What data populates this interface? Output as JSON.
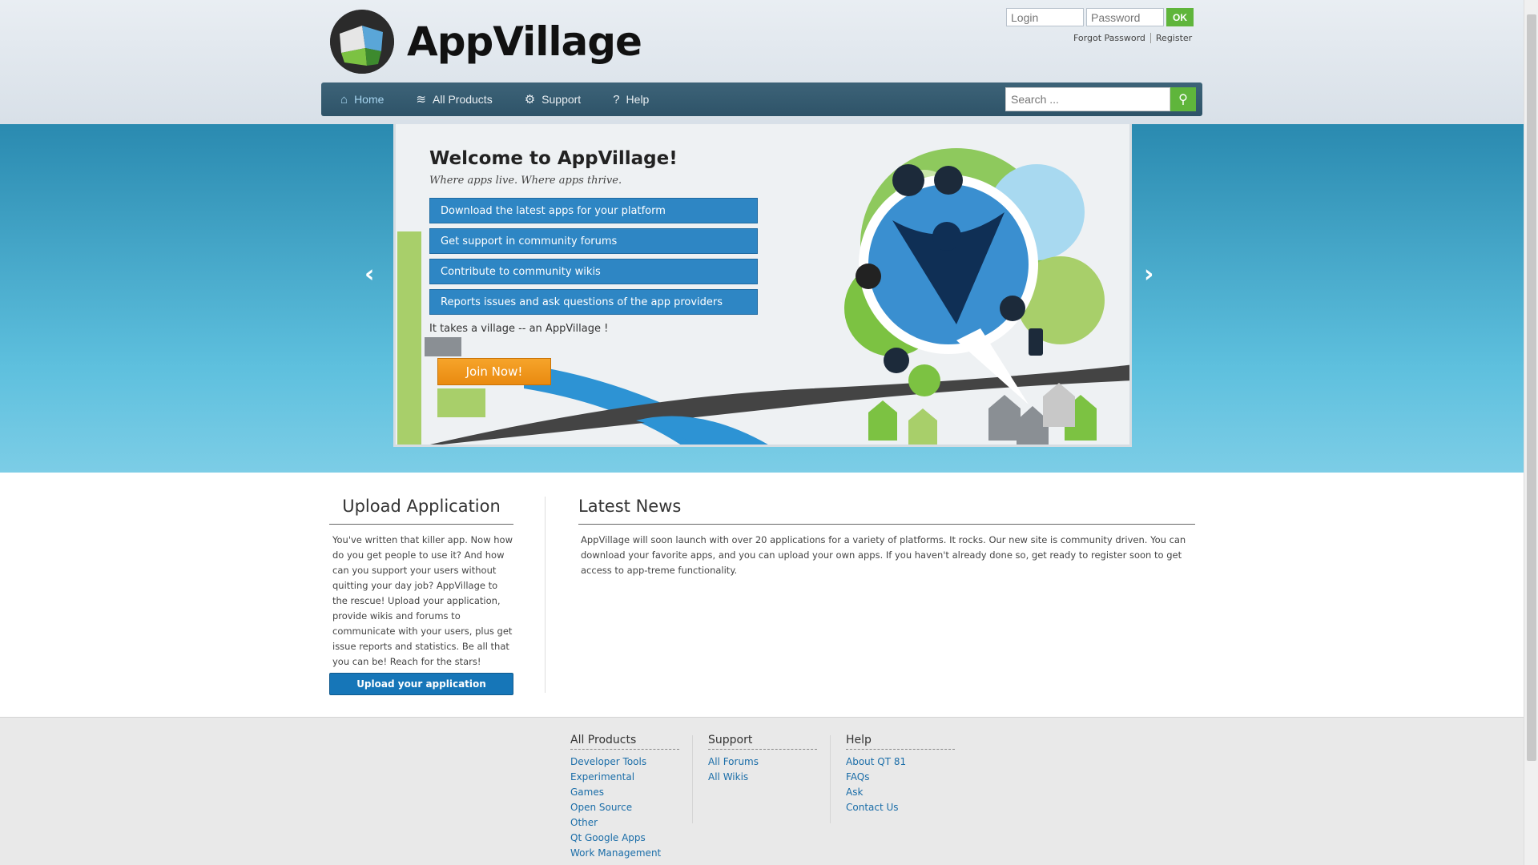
{
  "brand": {
    "name": "AppVillage"
  },
  "login": {
    "login_placeholder": "Login",
    "password_placeholder": "Password",
    "ok_label": "OK",
    "forgot_label": "Forgot Password",
    "register_label": "Register"
  },
  "nav": {
    "items": [
      {
        "label": "Home",
        "icon": "home-icon"
      },
      {
        "label": "All Products",
        "icon": "layers-icon"
      },
      {
        "label": "Support",
        "icon": "gear-icon"
      },
      {
        "label": "Help",
        "icon": "question-icon"
      }
    ],
    "search_placeholder": "Search ..."
  },
  "hero": {
    "title": "Welcome to AppVillage!",
    "subtitle": "Where apps live. Where apps thrive.",
    "features": [
      "Download the latest apps for your platform",
      "Get support in community forums",
      "Contribute to community wikis",
      "Reports issues and ask questions of the app providers"
    ],
    "tagline": "It takes a village -- an AppVillage !",
    "join_label": "Join Now!"
  },
  "upload": {
    "title": "Upload Application",
    "text": "You've written that killer app. Now how do you get people to use it? And how can you support your users without quitting your day job? AppVillage to the rescue! Upload your application, provide wikis and forums to communicate with your users, plus get issue reports and statistics. Be all that you can be! Reach for the stars!",
    "button_label": "Upload your application"
  },
  "news": {
    "title": "Latest News",
    "text": "AppVillage will soon launch with over 20 applications for a variety of platforms. It rocks. Our new site is community driven. You can download your favorite apps, and you can upload your own apps. If you haven't already done so, get ready to register soon to get access to app-treme functionality."
  },
  "footer": {
    "columns": [
      {
        "title": "All Products",
        "links": [
          "Developer Tools",
          "Experimental",
          "Games",
          "Open Source",
          "Other",
          "Qt Google Apps",
          "Work Management"
        ]
      },
      {
        "title": "Support",
        "links": [
          "All Forums",
          "All Wikis"
        ]
      },
      {
        "title": "Help",
        "links": [
          "About QT 81",
          "FAQs",
          "Ask",
          "Contact Us"
        ]
      }
    ]
  },
  "colors": {
    "nav_bg": "#2e5368",
    "accent_green": "#5fb53b",
    "feature_blue": "#2e86c4",
    "join_orange": "#f39c1f",
    "link_blue": "#1a6da8"
  }
}
